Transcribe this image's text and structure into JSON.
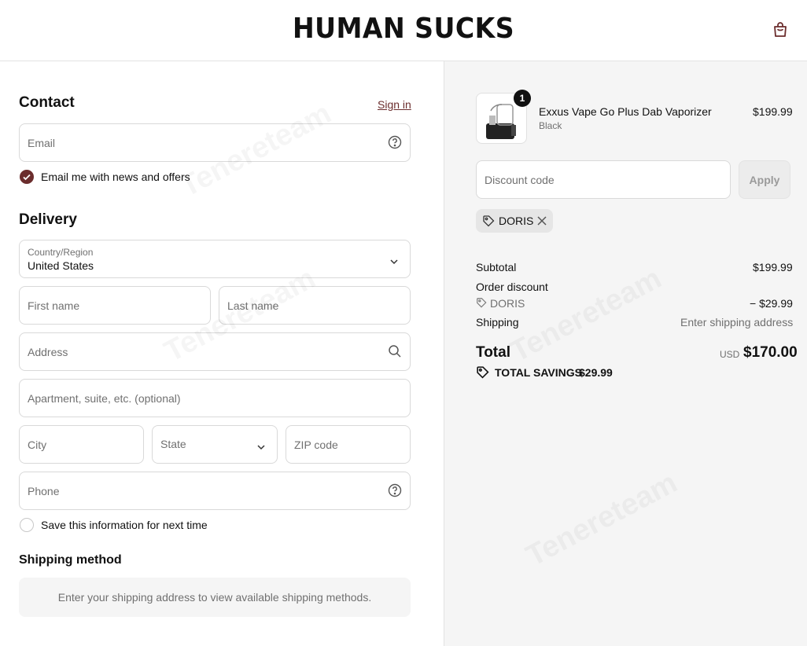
{
  "header": {
    "brand": "HUMAN SUCKS",
    "cart_icon": "shopping-bag-icon"
  },
  "contact": {
    "title": "Contact",
    "sign_in": "Sign in",
    "email_placeholder": "Email",
    "news_checkbox_label": "Email me with news and offers",
    "news_checked": true
  },
  "delivery": {
    "title": "Delivery",
    "country_label": "Country/Region",
    "country_value": "United States",
    "first_name_placeholder": "First name",
    "last_name_placeholder": "Last name",
    "address_placeholder": "Address",
    "apartment_placeholder": "Apartment, suite, etc. (optional)",
    "city_placeholder": "City",
    "state_placeholder": "State",
    "zip_placeholder": "ZIP code",
    "phone_placeholder": "Phone",
    "save_info_label": "Save this information for next time",
    "save_info_checked": false
  },
  "shipping_method": {
    "title": "Shipping method",
    "message": "Enter your shipping address to view available shipping methods."
  },
  "summary": {
    "product": {
      "name": "Exxus Vape Go Plus Dab Vaporizer",
      "variant": "Black",
      "price": "$199.99",
      "quantity": "1"
    },
    "discount_placeholder": "Discount code",
    "apply_label": "Apply",
    "applied_code": "DORIS",
    "subtotal_label": "Subtotal",
    "subtotal_value": "$199.99",
    "order_discount_label": "Order discount",
    "discount_code": "DORIS",
    "discount_value": "− $29.99",
    "shipping_label": "Shipping",
    "shipping_value": "Enter shipping address",
    "total_label": "Total",
    "currency": "USD",
    "total_value": "$170.00",
    "savings_label": "TOTAL SAVINGS",
    "savings_value": "$29.99"
  },
  "colors": {
    "accent": "#6b2d2d",
    "panel": "#f5f5f5"
  }
}
